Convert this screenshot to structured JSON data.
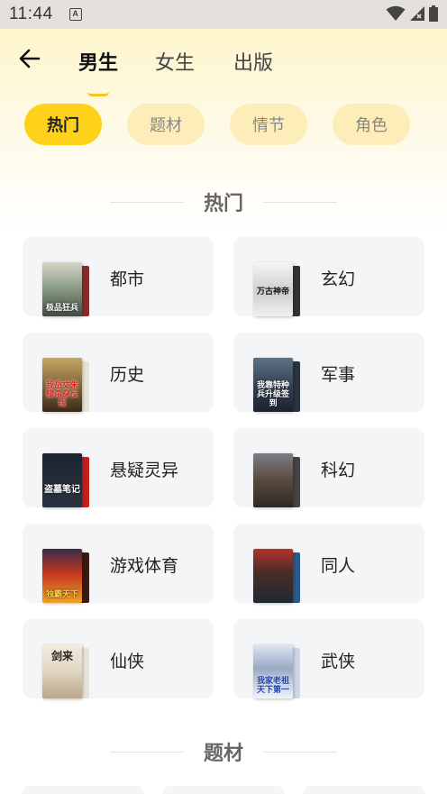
{
  "status": {
    "time": "11:44",
    "notify_letter": "A"
  },
  "nav": {
    "tabs": [
      {
        "label": "男生",
        "active": true
      },
      {
        "label": "女生",
        "active": false
      },
      {
        "label": "出版",
        "active": false
      }
    ]
  },
  "chips": [
    {
      "label": "热门",
      "active": true
    },
    {
      "label": "题材",
      "active": false
    },
    {
      "label": "情节",
      "active": false
    },
    {
      "label": "角色",
      "active": false
    }
  ],
  "section_hot": {
    "title": "热门"
  },
  "section_topic": {
    "title": "题材"
  },
  "categories": [
    {
      "label": "都市",
      "cover_text": "极品狂兵"
    },
    {
      "label": "玄幻",
      "cover_text": "万古神帝"
    },
    {
      "label": "历史",
      "cover_text": "我岳丈朱棣杀穿反叛"
    },
    {
      "label": "军事",
      "cover_text": "我靠特种兵升级签到"
    },
    {
      "label": "悬疑灵异",
      "cover_text": "盗墓笔记"
    },
    {
      "label": "科幻",
      "cover_text": ""
    },
    {
      "label": "游戏体育",
      "cover_text": "独霸天下"
    },
    {
      "label": "同人",
      "cover_text": ""
    },
    {
      "label": "仙侠",
      "cover_text": "剑来"
    },
    {
      "label": "武侠",
      "cover_text": "我家老祖天下第一"
    }
  ],
  "colors": {
    "accent": "#fed21b",
    "chip_inactive": "#fcedb9",
    "card_bg": "#f4f5f7"
  }
}
